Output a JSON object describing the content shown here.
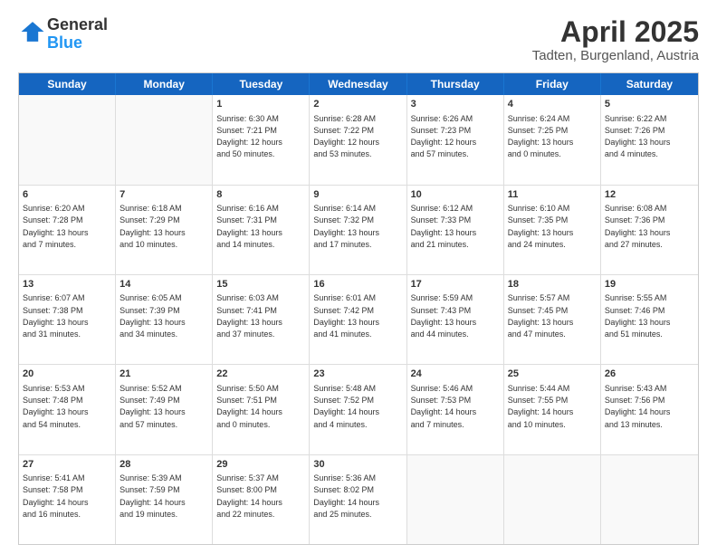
{
  "header": {
    "logo_general": "General",
    "logo_blue": "Blue",
    "month": "April 2025",
    "location": "Tadten, Burgenland, Austria"
  },
  "weekdays": [
    "Sunday",
    "Monday",
    "Tuesday",
    "Wednesday",
    "Thursday",
    "Friday",
    "Saturday"
  ],
  "rows": [
    [
      {
        "day": "",
        "empty": true
      },
      {
        "day": "",
        "empty": true
      },
      {
        "day": "1",
        "lines": [
          "Sunrise: 6:30 AM",
          "Sunset: 7:21 PM",
          "Daylight: 12 hours",
          "and 50 minutes."
        ]
      },
      {
        "day": "2",
        "lines": [
          "Sunrise: 6:28 AM",
          "Sunset: 7:22 PM",
          "Daylight: 12 hours",
          "and 53 minutes."
        ]
      },
      {
        "day": "3",
        "lines": [
          "Sunrise: 6:26 AM",
          "Sunset: 7:23 PM",
          "Daylight: 12 hours",
          "and 57 minutes."
        ]
      },
      {
        "day": "4",
        "lines": [
          "Sunrise: 6:24 AM",
          "Sunset: 7:25 PM",
          "Daylight: 13 hours",
          "and 0 minutes."
        ]
      },
      {
        "day": "5",
        "lines": [
          "Sunrise: 6:22 AM",
          "Sunset: 7:26 PM",
          "Daylight: 13 hours",
          "and 4 minutes."
        ]
      }
    ],
    [
      {
        "day": "6",
        "lines": [
          "Sunrise: 6:20 AM",
          "Sunset: 7:28 PM",
          "Daylight: 13 hours",
          "and 7 minutes."
        ]
      },
      {
        "day": "7",
        "lines": [
          "Sunrise: 6:18 AM",
          "Sunset: 7:29 PM",
          "Daylight: 13 hours",
          "and 10 minutes."
        ]
      },
      {
        "day": "8",
        "lines": [
          "Sunrise: 6:16 AM",
          "Sunset: 7:31 PM",
          "Daylight: 13 hours",
          "and 14 minutes."
        ]
      },
      {
        "day": "9",
        "lines": [
          "Sunrise: 6:14 AM",
          "Sunset: 7:32 PM",
          "Daylight: 13 hours",
          "and 17 minutes."
        ]
      },
      {
        "day": "10",
        "lines": [
          "Sunrise: 6:12 AM",
          "Sunset: 7:33 PM",
          "Daylight: 13 hours",
          "and 21 minutes."
        ]
      },
      {
        "day": "11",
        "lines": [
          "Sunrise: 6:10 AM",
          "Sunset: 7:35 PM",
          "Daylight: 13 hours",
          "and 24 minutes."
        ]
      },
      {
        "day": "12",
        "lines": [
          "Sunrise: 6:08 AM",
          "Sunset: 7:36 PM",
          "Daylight: 13 hours",
          "and 27 minutes."
        ]
      }
    ],
    [
      {
        "day": "13",
        "lines": [
          "Sunrise: 6:07 AM",
          "Sunset: 7:38 PM",
          "Daylight: 13 hours",
          "and 31 minutes."
        ]
      },
      {
        "day": "14",
        "lines": [
          "Sunrise: 6:05 AM",
          "Sunset: 7:39 PM",
          "Daylight: 13 hours",
          "and 34 minutes."
        ]
      },
      {
        "day": "15",
        "lines": [
          "Sunrise: 6:03 AM",
          "Sunset: 7:41 PM",
          "Daylight: 13 hours",
          "and 37 minutes."
        ]
      },
      {
        "day": "16",
        "lines": [
          "Sunrise: 6:01 AM",
          "Sunset: 7:42 PM",
          "Daylight: 13 hours",
          "and 41 minutes."
        ]
      },
      {
        "day": "17",
        "lines": [
          "Sunrise: 5:59 AM",
          "Sunset: 7:43 PM",
          "Daylight: 13 hours",
          "and 44 minutes."
        ]
      },
      {
        "day": "18",
        "lines": [
          "Sunrise: 5:57 AM",
          "Sunset: 7:45 PM",
          "Daylight: 13 hours",
          "and 47 minutes."
        ]
      },
      {
        "day": "19",
        "lines": [
          "Sunrise: 5:55 AM",
          "Sunset: 7:46 PM",
          "Daylight: 13 hours",
          "and 51 minutes."
        ]
      }
    ],
    [
      {
        "day": "20",
        "lines": [
          "Sunrise: 5:53 AM",
          "Sunset: 7:48 PM",
          "Daylight: 13 hours",
          "and 54 minutes."
        ]
      },
      {
        "day": "21",
        "lines": [
          "Sunrise: 5:52 AM",
          "Sunset: 7:49 PM",
          "Daylight: 13 hours",
          "and 57 minutes."
        ]
      },
      {
        "day": "22",
        "lines": [
          "Sunrise: 5:50 AM",
          "Sunset: 7:51 PM",
          "Daylight: 14 hours",
          "and 0 minutes."
        ]
      },
      {
        "day": "23",
        "lines": [
          "Sunrise: 5:48 AM",
          "Sunset: 7:52 PM",
          "Daylight: 14 hours",
          "and 4 minutes."
        ]
      },
      {
        "day": "24",
        "lines": [
          "Sunrise: 5:46 AM",
          "Sunset: 7:53 PM",
          "Daylight: 14 hours",
          "and 7 minutes."
        ]
      },
      {
        "day": "25",
        "lines": [
          "Sunrise: 5:44 AM",
          "Sunset: 7:55 PM",
          "Daylight: 14 hours",
          "and 10 minutes."
        ]
      },
      {
        "day": "26",
        "lines": [
          "Sunrise: 5:43 AM",
          "Sunset: 7:56 PM",
          "Daylight: 14 hours",
          "and 13 minutes."
        ]
      }
    ],
    [
      {
        "day": "27",
        "lines": [
          "Sunrise: 5:41 AM",
          "Sunset: 7:58 PM",
          "Daylight: 14 hours",
          "and 16 minutes."
        ]
      },
      {
        "day": "28",
        "lines": [
          "Sunrise: 5:39 AM",
          "Sunset: 7:59 PM",
          "Daylight: 14 hours",
          "and 19 minutes."
        ]
      },
      {
        "day": "29",
        "lines": [
          "Sunrise: 5:37 AM",
          "Sunset: 8:00 PM",
          "Daylight: 14 hours",
          "and 22 minutes."
        ]
      },
      {
        "day": "30",
        "lines": [
          "Sunrise: 5:36 AM",
          "Sunset: 8:02 PM",
          "Daylight: 14 hours",
          "and 25 minutes."
        ]
      },
      {
        "day": "",
        "empty": true
      },
      {
        "day": "",
        "empty": true
      },
      {
        "day": "",
        "empty": true
      }
    ]
  ]
}
